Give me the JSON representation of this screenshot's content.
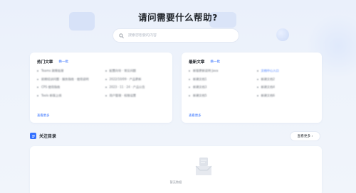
{
  "header": {
    "title": "请问需要什么帮助?"
  },
  "search": {
    "placeholder": "搜索您想要的内容"
  },
  "hot": {
    "title": "热门文章",
    "switch_label": "换一批",
    "items": [
      "Teams 故障处理",
      "配置向导 · 常见问题",
      "前期培训问题 · 服务指南 · 使用说明",
      "2022/10/09 · 产品更新",
      "CPS 使用指南",
      "2023 · 11 · 24 · 产品公告",
      "Tools 新版上线",
      "用户管理 · 权限设置"
    ],
    "more_label": "查看更多"
  },
  "latest": {
    "title": "最新文章",
    "switch_label": "换一批",
    "items": [
      "新版更新说明 Java",
      "文档中心入口",
      "新建文档1",
      "新建文档2",
      "新建文档3",
      "新建文档4",
      "新建文档5",
      "新建文档6"
    ],
    "more_label": "查看更多"
  },
  "follow": {
    "title": "关注目录",
    "more_label": "查看更多 ›",
    "empty_text": "暂无数据"
  },
  "colors": {
    "accent": "#3370ff",
    "background": "#eef3fb"
  }
}
